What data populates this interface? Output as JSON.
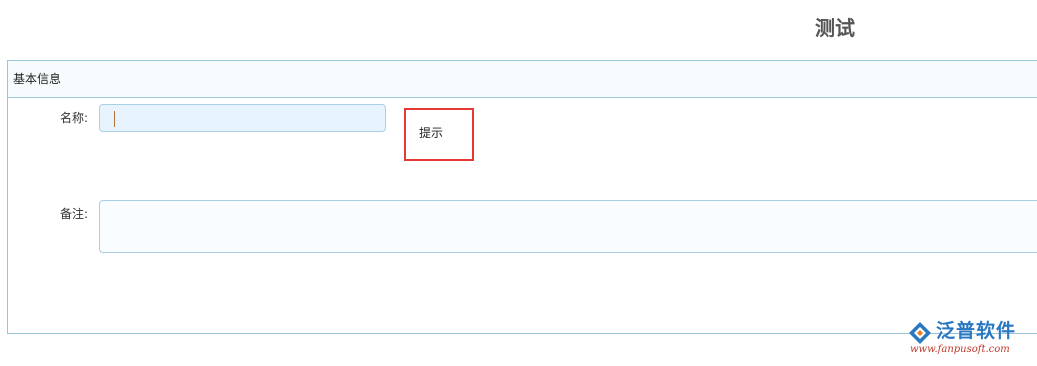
{
  "page": {
    "title": "测试"
  },
  "panel": {
    "header_label": "基本信息"
  },
  "form": {
    "name_label": "名称:",
    "name_value": "",
    "hint_label": "提示",
    "remark_label": "备注:",
    "remark_value": ""
  },
  "logo": {
    "name": "泛普软件",
    "url": "www.fanpusoft.com",
    "brand_color": "#2a78c2",
    "url_color": "#c0392b"
  },
  "colors": {
    "panel_border": "#9cc4db",
    "input_bg": "#e8f4fd",
    "highlight_border": "#e53935"
  }
}
